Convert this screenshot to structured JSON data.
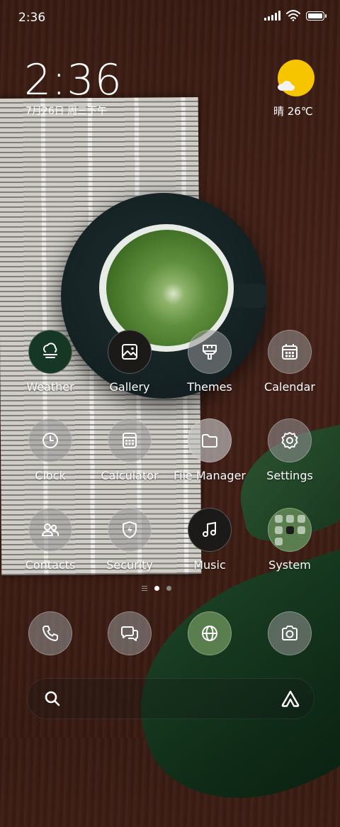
{
  "status_bar": {
    "time": "2:36"
  },
  "clock_widget": {
    "time": "2:36",
    "date": "7月26日 周三下午"
  },
  "weather_widget": {
    "text": "晴 26℃"
  },
  "apps": [
    {
      "label": "Weather",
      "icon": "weather-icon"
    },
    {
      "label": "Gallery",
      "icon": "gallery-icon"
    },
    {
      "label": "Themes",
      "icon": "themes-icon"
    },
    {
      "label": "Calendar",
      "icon": "calendar-icon"
    },
    {
      "label": "Clock",
      "icon": "clock-icon"
    },
    {
      "label": "Calculator",
      "icon": "calculator-icon"
    },
    {
      "label": "File Manager",
      "icon": "folder-icon"
    },
    {
      "label": "Settings",
      "icon": "gear-icon"
    },
    {
      "label": "Contacts",
      "icon": "contacts-icon"
    },
    {
      "label": "Security",
      "icon": "shield-icon"
    },
    {
      "label": "Music",
      "icon": "music-icon"
    },
    {
      "label": "System",
      "icon": "folder-grid-icon"
    }
  ],
  "dock": [
    {
      "icon": "phone-icon"
    },
    {
      "icon": "messages-icon"
    },
    {
      "icon": "globe-icon"
    },
    {
      "icon": "camera-icon"
    }
  ],
  "pager": {
    "pages": 2,
    "active_page": 1
  },
  "colors": {
    "sun": "#f7c400",
    "wallpaper_wood": "#47231a"
  }
}
